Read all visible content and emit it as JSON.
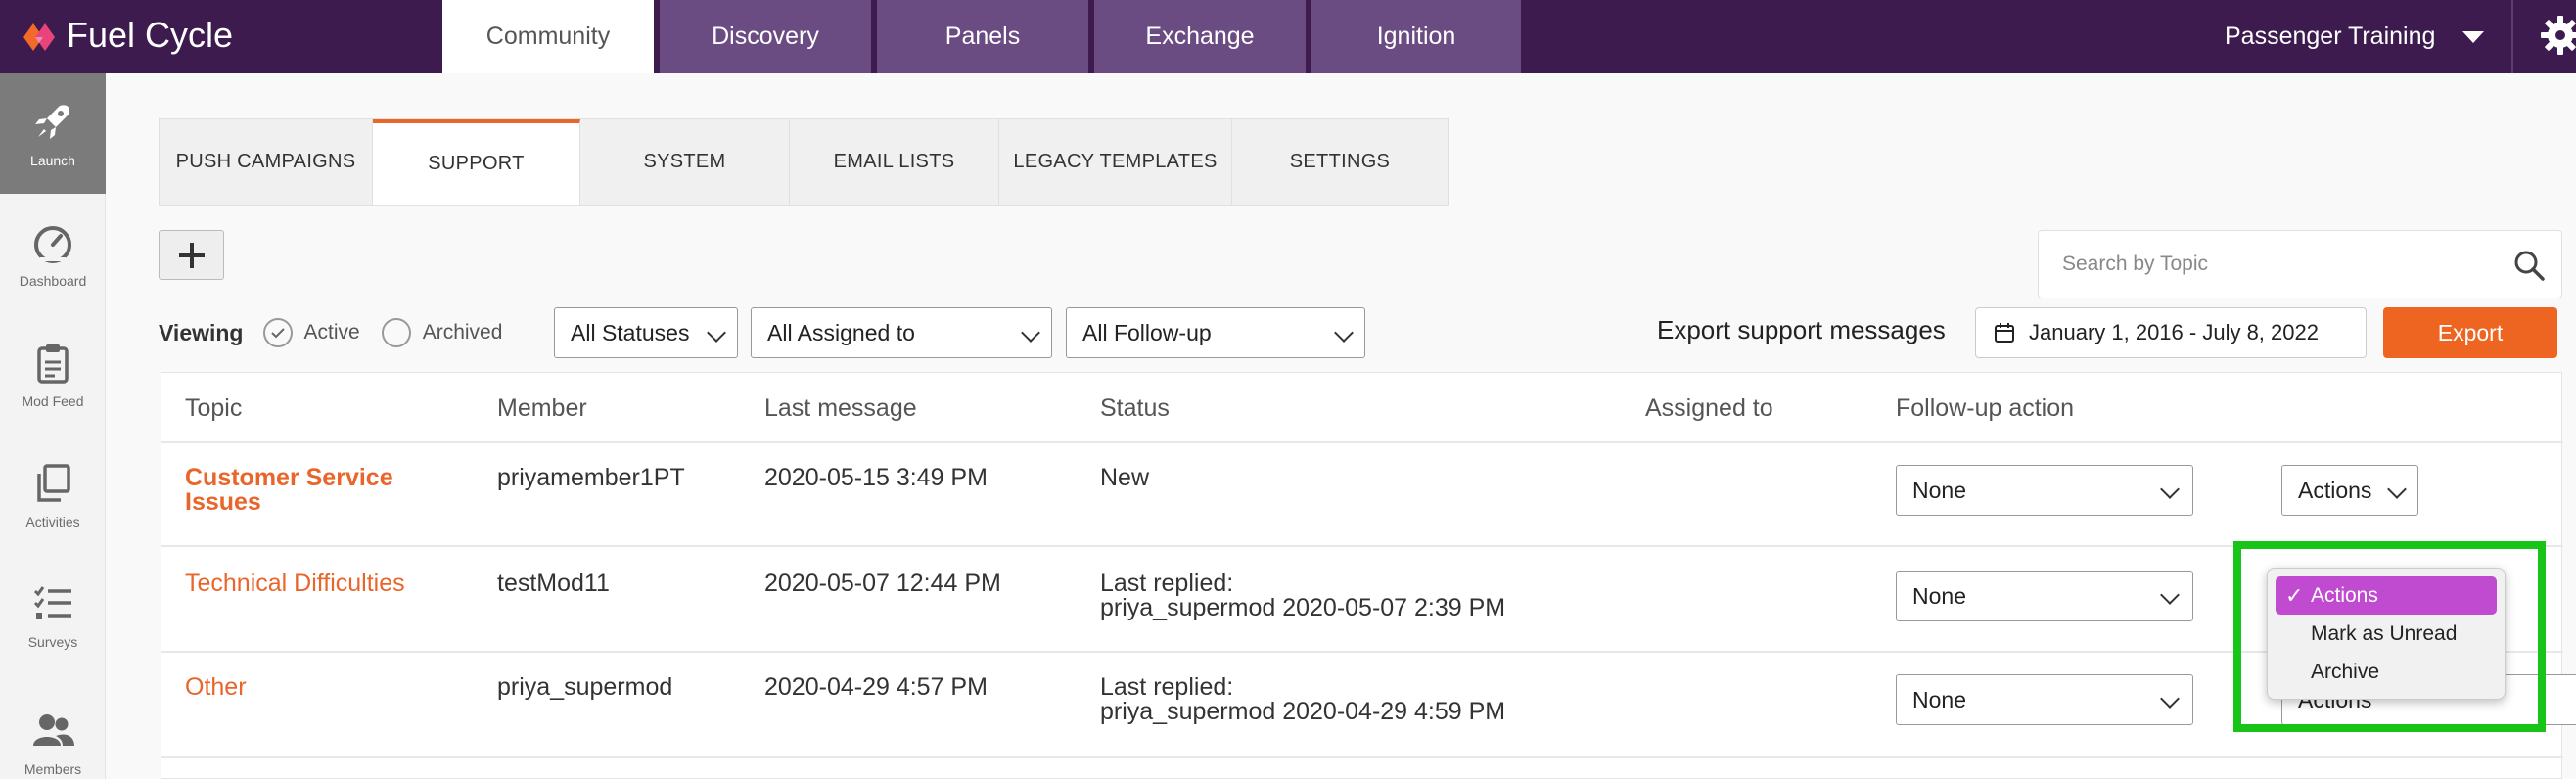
{
  "app": {
    "logo_text": "Fuel Cycle",
    "brand_colors": {
      "topbar": "#3d1b4e",
      "accent": "#e9652a",
      "highlight": "#17c417",
      "selected_option": "#c04bd0"
    }
  },
  "main_tabs": [
    {
      "label": "Community",
      "active": true
    },
    {
      "label": "Discovery",
      "active": false
    },
    {
      "label": "Panels",
      "active": false
    },
    {
      "label": "Exchange",
      "active": false
    },
    {
      "label": "Ignition",
      "active": false
    }
  ],
  "account": {
    "name": "Passenger Training",
    "icon": "chevron-down-icon"
  },
  "sidebar": {
    "items": [
      {
        "label": "Launch",
        "icon": "rocket-icon",
        "active": true
      },
      {
        "label": "Dashboard",
        "icon": "gauge-icon",
        "active": false
      },
      {
        "label": "Mod Feed",
        "icon": "clipboard-icon",
        "active": false
      },
      {
        "label": "Activities",
        "icon": "copy-icon",
        "active": false
      },
      {
        "label": "Surveys",
        "icon": "checklist-icon",
        "active": false
      },
      {
        "label": "Members",
        "icon": "users-icon",
        "active": false
      }
    ]
  },
  "sub_tabs": [
    {
      "label": "PUSH CAMPAIGNS",
      "active": false
    },
    {
      "label": "SUPPORT",
      "active": true
    },
    {
      "label": "SYSTEM",
      "active": false
    },
    {
      "label": "EMAIL LISTS",
      "active": false
    },
    {
      "label": "LEGACY TEMPLATES",
      "active": false
    },
    {
      "label": "SETTINGS",
      "active": false
    }
  ],
  "search": {
    "placeholder": "Search by Topic"
  },
  "filters": {
    "viewing_label": "Viewing",
    "radio_active": "Active",
    "radio_archived": "Archived",
    "selected_radio": "Active",
    "status_select": "All Statuses",
    "assigned_select": "All Assigned to",
    "followup_select": "All Follow-up"
  },
  "export": {
    "label": "Export support messages",
    "date_range": "January 1, 2016 - July 8, 2022",
    "button": "Export"
  },
  "table": {
    "headers": [
      "Topic",
      "Member",
      "Last message",
      "Status",
      "Assigned to",
      "Follow-up action"
    ],
    "rows": [
      {
        "topic_line1": "Customer Service",
        "topic_line2": "Issues",
        "member": "priyamember1PT",
        "last_message": "2020-05-15 3:49 PM",
        "status_line1": "New",
        "status_line2": "",
        "assigned_to": "",
        "followup": "None",
        "actions": "Actions"
      },
      {
        "topic_line1": "Technical Difficulties",
        "topic_line2": "",
        "member": "testMod11",
        "last_message": "2020-05-07 12:44 PM",
        "status_line1": "Last replied:",
        "status_line2": "priya_supermod 2020-05-07 2:39 PM",
        "assigned_to": "",
        "followup": "None",
        "actions": "Actions"
      },
      {
        "topic_line1": "Other",
        "topic_line2": "",
        "member": "priya_supermod",
        "last_message": "2020-04-29 4:57 PM",
        "status_line1": "Last replied:",
        "status_line2": "priya_supermod 2020-04-29 4:59 PM",
        "assigned_to": "",
        "followup": "None",
        "actions": "Actions"
      }
    ]
  },
  "actions_dropdown": {
    "options": [
      {
        "label": "Actions",
        "selected": true
      },
      {
        "label": "Mark as Unread",
        "selected": false
      },
      {
        "label": "Archive",
        "selected": false
      }
    ],
    "check_glyph": "✓"
  }
}
